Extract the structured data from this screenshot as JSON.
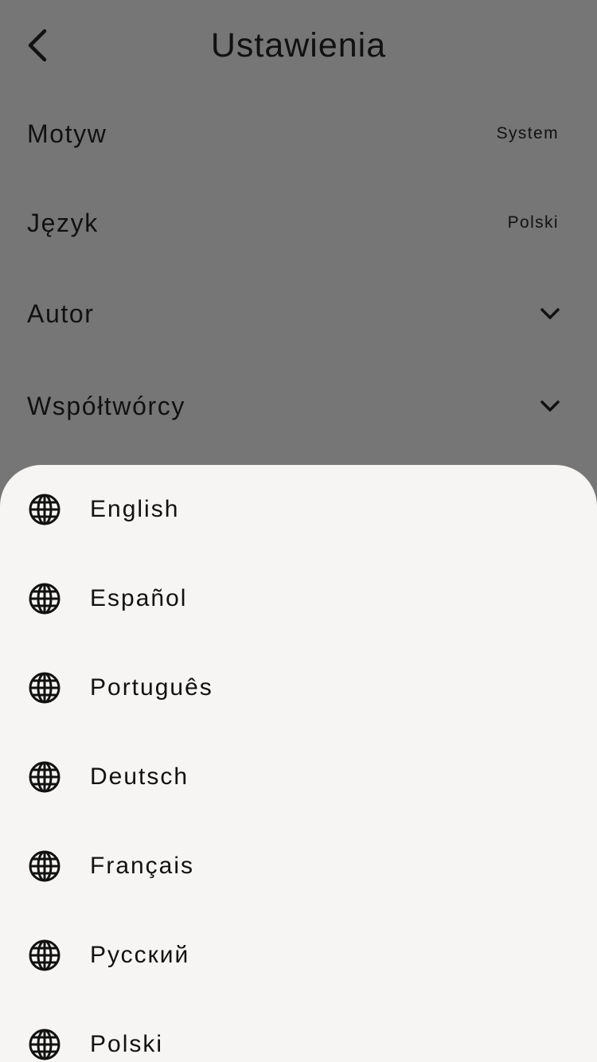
{
  "header": {
    "title": "Ustawienia",
    "back_icon": "chevron-left-icon"
  },
  "settings": [
    {
      "label": "Motyw",
      "value": "System",
      "kind": "value"
    },
    {
      "label": "Język",
      "value": "Polski",
      "kind": "value"
    },
    {
      "label": "Autor",
      "kind": "expand",
      "icon": "chevron-down-icon"
    },
    {
      "label": "Współtwórcy",
      "kind": "expand",
      "icon": "chevron-down-icon"
    }
  ],
  "language_sheet": {
    "icon": "globe-icon",
    "items": [
      {
        "label": "English"
      },
      {
        "label": "Español"
      },
      {
        "label": "Português"
      },
      {
        "label": "Deutsch"
      },
      {
        "label": "Français"
      },
      {
        "label": "Русский"
      },
      {
        "label": "Polski"
      }
    ]
  },
  "colors": {
    "overlay_background": "#767676",
    "sheet_background": "#f6f5f3",
    "text": "#111111"
  }
}
